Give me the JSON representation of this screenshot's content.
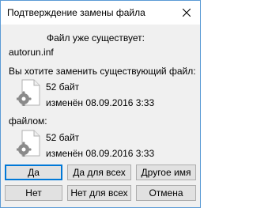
{
  "window": {
    "title": "Подтверждение замены файла",
    "close_icon": "close-icon"
  },
  "message": {
    "exists_line": "Файл уже существует:",
    "filename": "autorun.inf",
    "question": "Вы хотите заменить существующий файл:",
    "with_label": "файлом:"
  },
  "existing_file": {
    "size": "52 байт",
    "modified": "изменён 08.09.2016 3:33",
    "icon": "settings-file-icon"
  },
  "new_file": {
    "size": "52 байт",
    "modified": "изменён 08.09.2016 3:33",
    "icon": "settings-file-icon"
  },
  "buttons": {
    "yes": "Да",
    "yes_all": "Да для всех",
    "rename": "Другое имя",
    "no": "Нет",
    "no_all": "Нет для всех",
    "cancel": "Отмена"
  },
  "colors": {
    "accent": "#0078d7",
    "window_border": "#5b9bd5"
  }
}
